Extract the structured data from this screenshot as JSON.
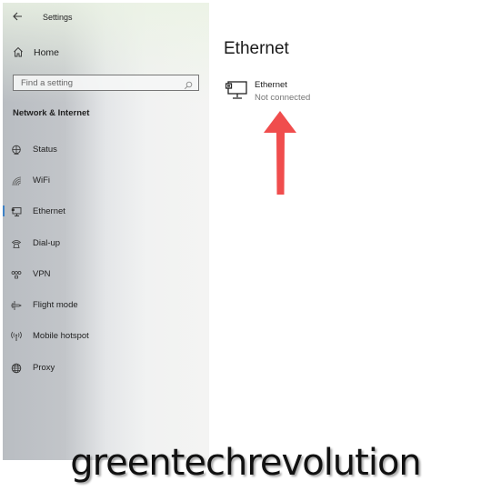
{
  "window": {
    "title": "Settings"
  },
  "sidebar": {
    "home_label": "Home",
    "search": {
      "placeholder": "Find a setting"
    },
    "section_title": "Network & Internet",
    "items": [
      {
        "label": "Status",
        "icon": "status-globe-icon",
        "active": false
      },
      {
        "label": "WiFi",
        "icon": "wifi-icon",
        "active": false
      },
      {
        "label": "Ethernet",
        "icon": "ethernet-icon",
        "active": true
      },
      {
        "label": "Dial-up",
        "icon": "dial-up-icon",
        "active": false
      },
      {
        "label": "VPN",
        "icon": "vpn-icon",
        "active": false
      },
      {
        "label": "Flight mode",
        "icon": "airplane-icon",
        "active": false
      },
      {
        "label": "Mobile hotspot",
        "icon": "hotspot-icon",
        "active": false
      },
      {
        "label": "Proxy",
        "icon": "globe-icon",
        "active": false
      }
    ]
  },
  "main": {
    "title": "Ethernet",
    "connection": {
      "name": "Ethernet",
      "status": "Not connected"
    }
  },
  "annotation": {
    "arrow_color": "#f04d4d"
  },
  "accent_color": "#3f82c6",
  "watermark": "greentechrevolution"
}
